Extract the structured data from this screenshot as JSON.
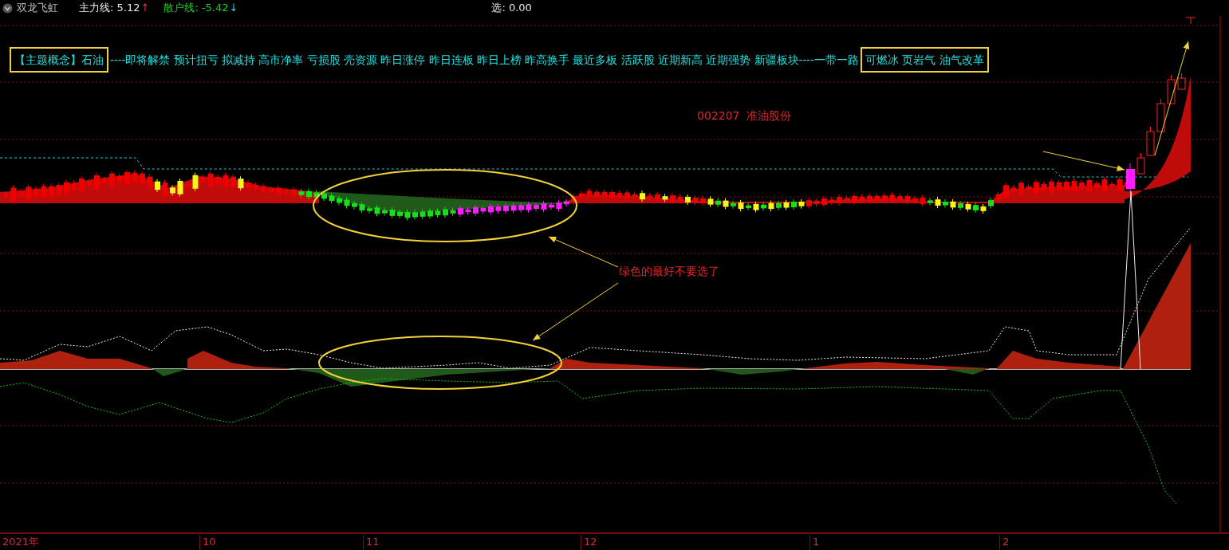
{
  "header": {
    "indicator": "双龙飞虹",
    "main_line": {
      "label": "主力线:",
      "value": "5.12",
      "arrow": "↑"
    },
    "retail_line": {
      "label": "散户线:",
      "value": "-5.42",
      "arrow": "↓"
    },
    "pick": {
      "label": "选:",
      "value": "0.00"
    }
  },
  "concepts": [
    {
      "text": "【主题概念】石油",
      "highlighted": true
    },
    {
      "text": "----即将解禁 预计扭亏 拟减持 高市净率 亏损股 壳资源 昨日涨停 昨日连板 昨日上榜 昨高换手 最近多板 活跃股 近期新高 近期强势 新疆板块----一带一路",
      "highlighted": false
    },
    {
      "text": "可燃冰 页岩气 油气改革",
      "highlighted": true
    }
  ],
  "annotations": [
    {
      "kind": "stock",
      "text": "002207  准油股份"
    },
    {
      "kind": "note",
      "text": "绿色的最好不要选了"
    }
  ],
  "time_axis": [
    "2021年",
    "10",
    "11",
    "12",
    "1",
    "2"
  ]
}
